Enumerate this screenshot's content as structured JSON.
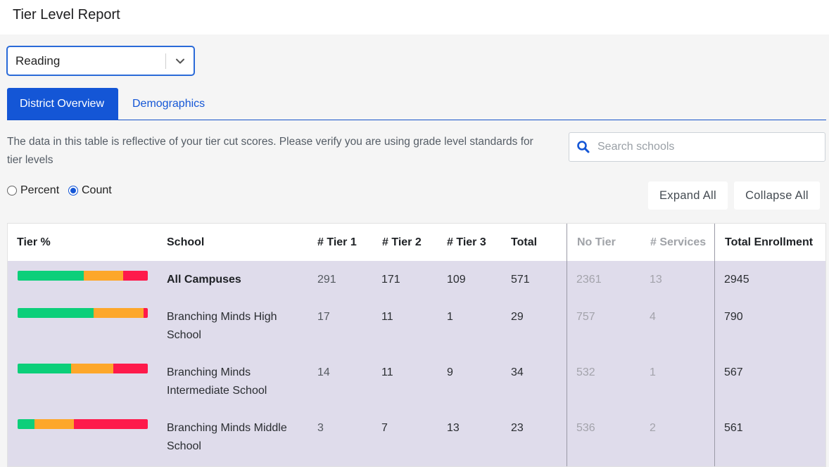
{
  "header": {
    "title": "Tier Level Report"
  },
  "subject_select": {
    "value": "Reading"
  },
  "tabs": [
    {
      "label": "District Overview"
    },
    {
      "label": "Demographics"
    }
  ],
  "note": "The data in this table is reflective of your tier cut scores. Please verify you are using grade level standards for tier levels",
  "search": {
    "placeholder": "Search schools"
  },
  "view_mode": {
    "percent_label": "Percent",
    "count_label": "Count",
    "selected": "Count"
  },
  "buttons": {
    "expand_all": "Expand All",
    "collapse_all": "Collapse All"
  },
  "colors": {
    "tier1": "#0ccf7a",
    "tier2": "#fda72a",
    "tier3": "#fe1a4b",
    "accent": "#1456d6"
  },
  "table": {
    "headers": {
      "tier_pct": "Tier %",
      "school": "School",
      "tier1": "# Tier 1",
      "tier2": "# Tier 2",
      "tier3": "# Tier 3",
      "total": "Total",
      "no_tier": "No Tier",
      "services": "# Services",
      "enrollment": "Total Enrollment"
    },
    "rows": [
      {
        "school": "All Campuses",
        "tier1": "291",
        "tier2": "171",
        "tier3": "109",
        "total": "571",
        "no_tier": "2361",
        "services": "13",
        "enrollment": "2945"
      },
      {
        "school": "Branching Minds High School",
        "tier1": "17",
        "tier2": "11",
        "tier3": "1",
        "total": "29",
        "no_tier": "757",
        "services": "4",
        "enrollment": "790"
      },
      {
        "school": "Branching Minds Intermediate School",
        "tier1": "14",
        "tier2": "11",
        "tier3": "9",
        "total": "34",
        "no_tier": "532",
        "services": "1",
        "enrollment": "567"
      },
      {
        "school": "Branching Minds Middle School",
        "tier1": "3",
        "tier2": "7",
        "tier3": "13",
        "total": "23",
        "no_tier": "536",
        "services": "2",
        "enrollment": "561"
      }
    ]
  }
}
